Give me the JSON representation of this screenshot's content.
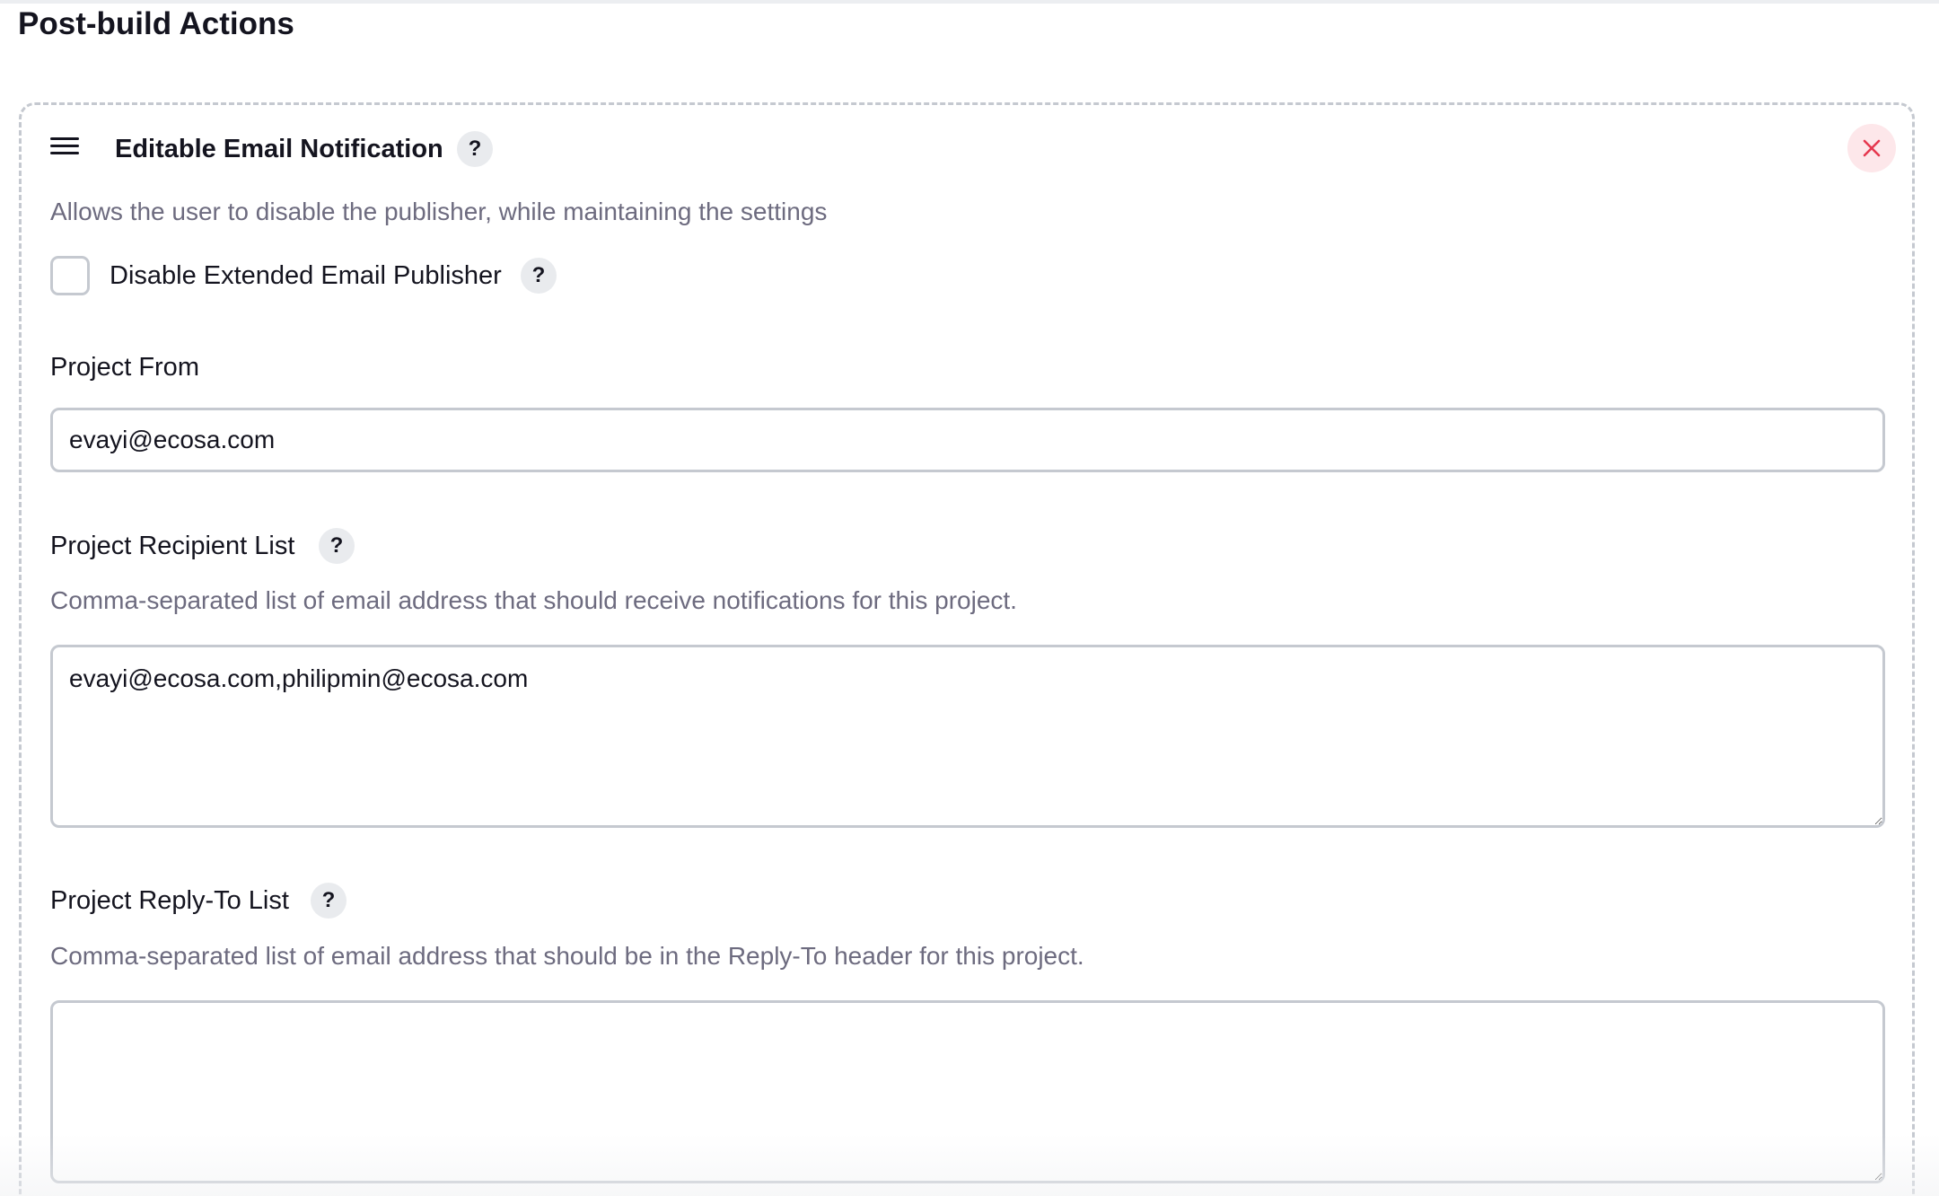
{
  "section": {
    "title": "Post-build Actions"
  },
  "panel": {
    "title": "Editable Email Notification",
    "description": "Allows the user to disable the publisher, while maintaining the settings",
    "close_icon": "close-icon",
    "drag_icon": "drag-handle-icon"
  },
  "disable_publisher": {
    "label": "Disable Extended Email Publisher",
    "checked": false
  },
  "help_label": "?",
  "project_from": {
    "label": "Project From",
    "value": "evayi@ecosa.com"
  },
  "recipient_list": {
    "label": "Project Recipient List",
    "description": "Comma-separated list of email address that should receive notifications for this project.",
    "value": "evayi@ecosa.com,philipmin@ecosa.com"
  },
  "reply_to_list": {
    "label": "Project Reply-To List",
    "description": "Comma-separated list of email address that should be in the Reply-To header for this project.",
    "value": ""
  },
  "colors": {
    "text": "#14141f",
    "description": "#6d6b7f",
    "border": "#c5c9d0",
    "close_bg": "#fde7ea",
    "close_icon": "#e5384f",
    "help_bg": "#e9ebee"
  }
}
